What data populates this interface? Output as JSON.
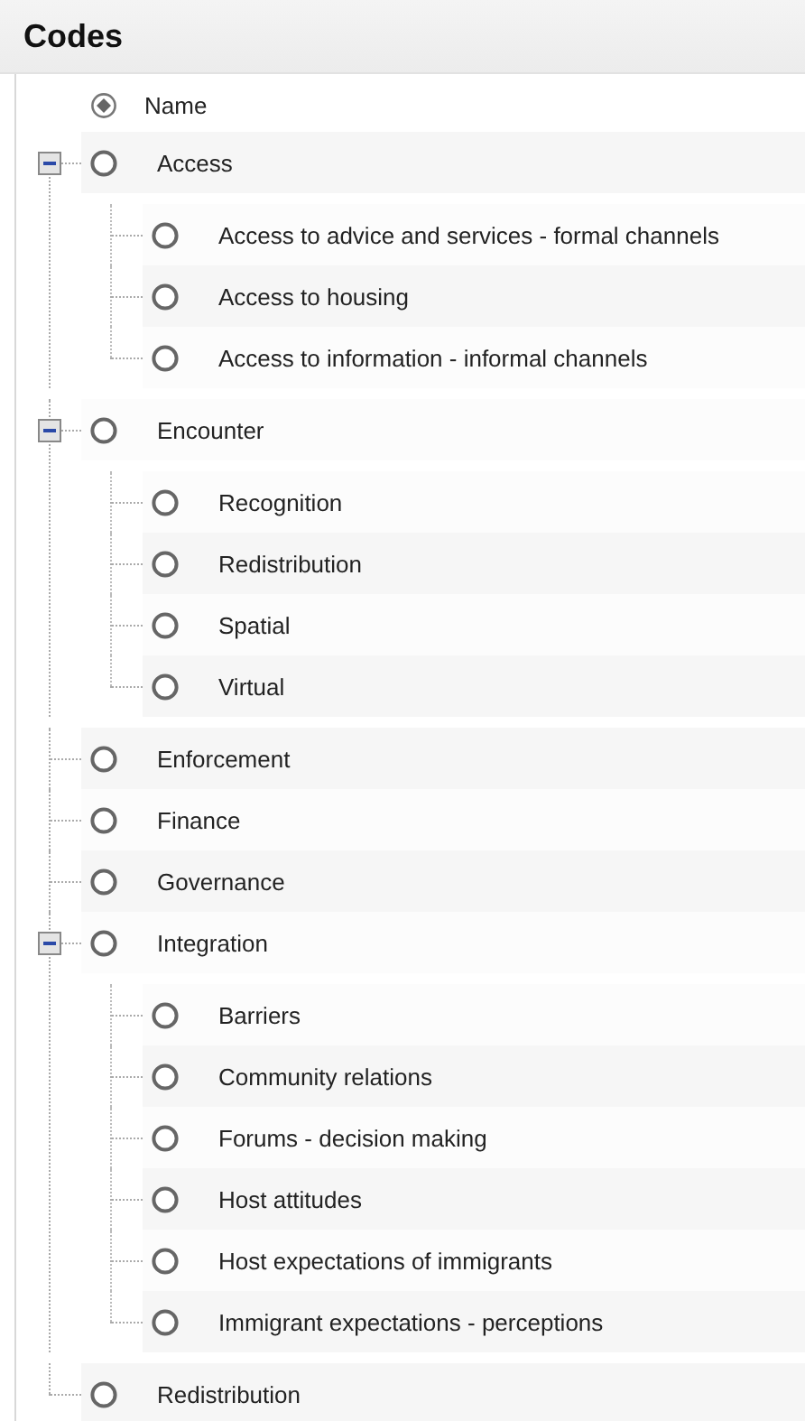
{
  "panel": {
    "title": "Codes"
  },
  "header": {
    "label": "Name"
  },
  "codes": [
    {
      "name": "Access",
      "expanded": true,
      "children": [
        {
          "name": "Access to advice and services - formal channels"
        },
        {
          "name": "Access to housing"
        },
        {
          "name": "Access to information - informal channels"
        }
      ]
    },
    {
      "name": "Encounter",
      "expanded": true,
      "children": [
        {
          "name": "Recognition"
        },
        {
          "name": "Redistribution"
        },
        {
          "name": "Spatial"
        },
        {
          "name": "Virtual"
        }
      ]
    },
    {
      "name": "Enforcement"
    },
    {
      "name": "Finance"
    },
    {
      "name": "Governance"
    },
    {
      "name": "Integration",
      "expanded": true,
      "children": [
        {
          "name": "Barriers"
        },
        {
          "name": "Community relations"
        },
        {
          "name": "Forums - decision making"
        },
        {
          "name": "Host attitudes"
        },
        {
          "name": "Host expectations of immigrants"
        },
        {
          "name": "Immigrant expectations - perceptions"
        }
      ]
    },
    {
      "name": "Redistribution"
    }
  ]
}
